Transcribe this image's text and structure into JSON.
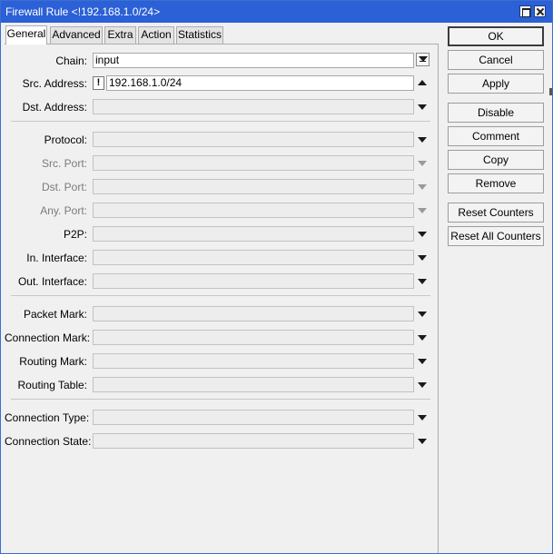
{
  "window": {
    "title": "Firewall Rule <!192.168.1.0/24>"
  },
  "tabs": [
    {
      "label": "General",
      "active": true
    },
    {
      "label": "Advanced"
    },
    {
      "label": "Extra"
    },
    {
      "label": "Action"
    },
    {
      "label": "Statistics"
    }
  ],
  "fields": {
    "chain": {
      "label": "Chain:",
      "value": "input"
    },
    "src_address": {
      "label": "Src. Address:",
      "not_flag": "!",
      "value": "192.168.1.0/24"
    },
    "dst_address": {
      "label": "Dst. Address:",
      "value": ""
    },
    "protocol": {
      "label": "Protocol:",
      "value": ""
    },
    "src_port": {
      "label": "Src. Port:",
      "value": "",
      "disabled": true
    },
    "dst_port": {
      "label": "Dst. Port:",
      "value": "",
      "disabled": true
    },
    "any_port": {
      "label": "Any. Port:",
      "value": "",
      "disabled": true
    },
    "p2p": {
      "label": "P2P:",
      "value": ""
    },
    "in_interface": {
      "label": "In. Interface:",
      "value": ""
    },
    "out_interface": {
      "label": "Out. Interface:",
      "value": ""
    },
    "packet_mark": {
      "label": "Packet Mark:",
      "value": ""
    },
    "connection_mark": {
      "label": "Connection Mark:",
      "value": ""
    },
    "routing_mark": {
      "label": "Routing Mark:",
      "value": ""
    },
    "routing_table": {
      "label": "Routing Table:",
      "value": ""
    },
    "connection_type": {
      "label": "Connection Type:",
      "value": ""
    },
    "connection_state": {
      "label": "Connection State:",
      "value": ""
    }
  },
  "buttons": {
    "ok": "OK",
    "cancel": "Cancel",
    "apply": "Apply",
    "disable": "Disable",
    "comment": "Comment",
    "copy": "Copy",
    "remove": "Remove",
    "reset_counters": "Reset Counters",
    "reset_all_counters": "Reset All Counters"
  },
  "colors": {
    "titlebar": "#2b60d6",
    "window_bg": "#f0f0f0"
  }
}
